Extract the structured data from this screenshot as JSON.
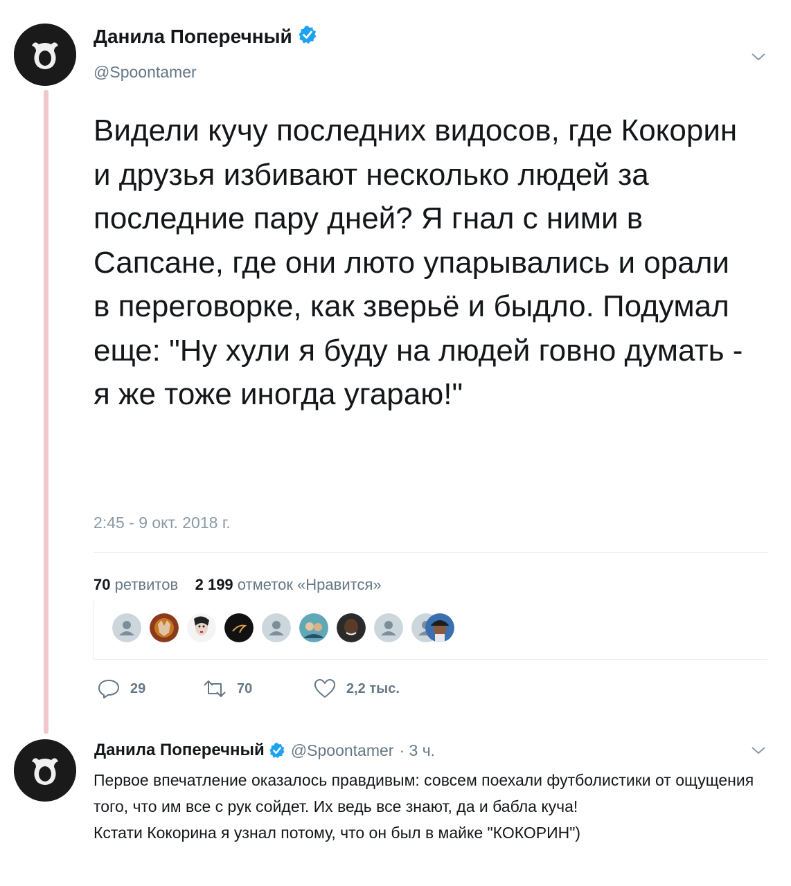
{
  "main_tweet": {
    "author_name": "Данила Поперечный",
    "handle": "@Spoontamer",
    "text": "Видели кучу последних видосов, где Кокорин и друзья избивают несколько людей за последние пару дней? Я гнал с ними в Сапсане, где они люто упарывались и орали в переговорке, как зверьё и быдло. Подумал еще: \"Ну хули я буду на людей говно думать - я же тоже иногда угараю!\"",
    "timestamp": "2:45 - 9 окт. 2018 г.",
    "retweets_count": "70",
    "retweets_label": "ретвитов",
    "likes_count": "2 199",
    "likes_label": "отметок «Нравится»",
    "likers": [
      "default",
      "wolf",
      "face",
      "dark",
      "default",
      "group",
      "person",
      "default",
      "cap"
    ]
  },
  "actions": {
    "reply_count": "29",
    "retweet_count": "70",
    "like_count": "2,2 тыс."
  },
  "reply_tweet": {
    "author_name": "Данила Поперечный",
    "handle": "@Spoontamer",
    "time": "· 3 ч.",
    "text_line1": "Первое впечатление оказалось правдивым: совсем поехали футболистики от ощущения того, что им все с рук сойдет. Их ведь все знают, да и бабла куча!",
    "text_line2": "Кстати Кокорина я узнал потому, что он был в майке \"КОКОРИН\")"
  },
  "colors": {
    "accent": "#1da1f2",
    "thread_line": "#f2c7cc",
    "muted": "#657786"
  }
}
